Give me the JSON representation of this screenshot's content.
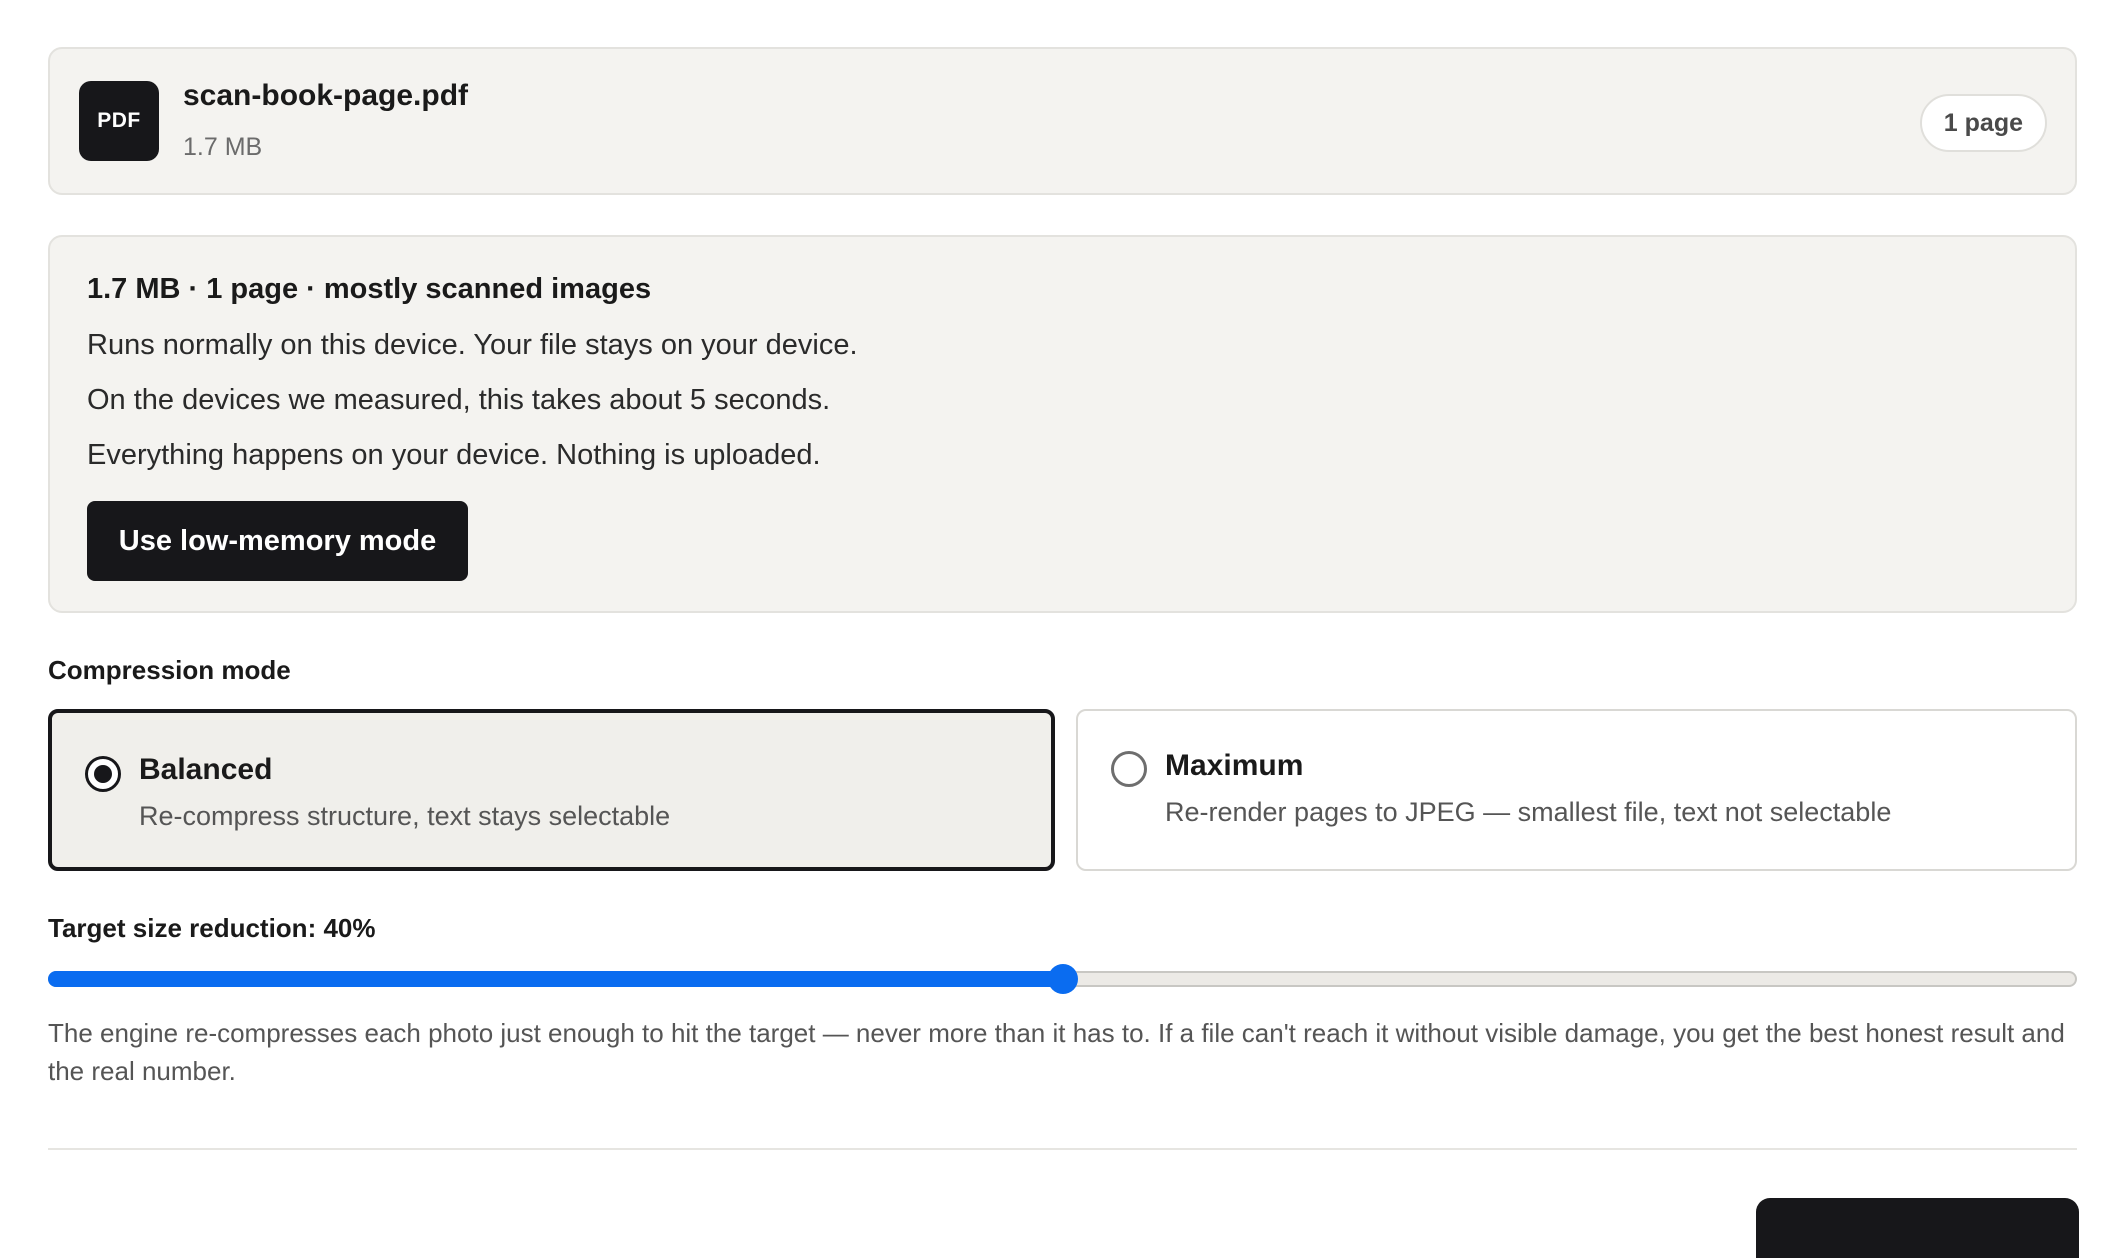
{
  "file": {
    "icon_label": "PDF",
    "name": "scan-book-page.pdf",
    "size": "1.7 MB",
    "pages_badge": "1 page"
  },
  "analysis": {
    "summary": "1.7 MB · 1 page · mostly scanned images",
    "lines": [
      "Runs normally on this device. Your file stays on your device.",
      "On the devices we measured, this takes about 5 seconds.",
      "Everything happens on your device. Nothing is uploaded."
    ],
    "low_memory_button": "Use low-memory mode"
  },
  "compression": {
    "label": "Compression mode",
    "selected": "balanced",
    "options": [
      {
        "id": "balanced",
        "title": "Balanced",
        "description": "Re-compress structure, text stays selectable"
      },
      {
        "id": "maximum",
        "title": "Maximum",
        "description": "Re-render pages to JPEG — smallest file, text not selectable"
      }
    ]
  },
  "target": {
    "label": "Target size reduction: 40%",
    "value_percent": 40,
    "slider_fill_fraction": 0.5,
    "explanation": "The engine re-compresses each photo just enough to hit the target — never more than it has to. If a file can't reach it without visible damage, you get the best honest result and the real number."
  },
  "colors": {
    "accent": "#0a6cf0",
    "dark": "#17171a",
    "card_background": "#f4f3f0"
  }
}
